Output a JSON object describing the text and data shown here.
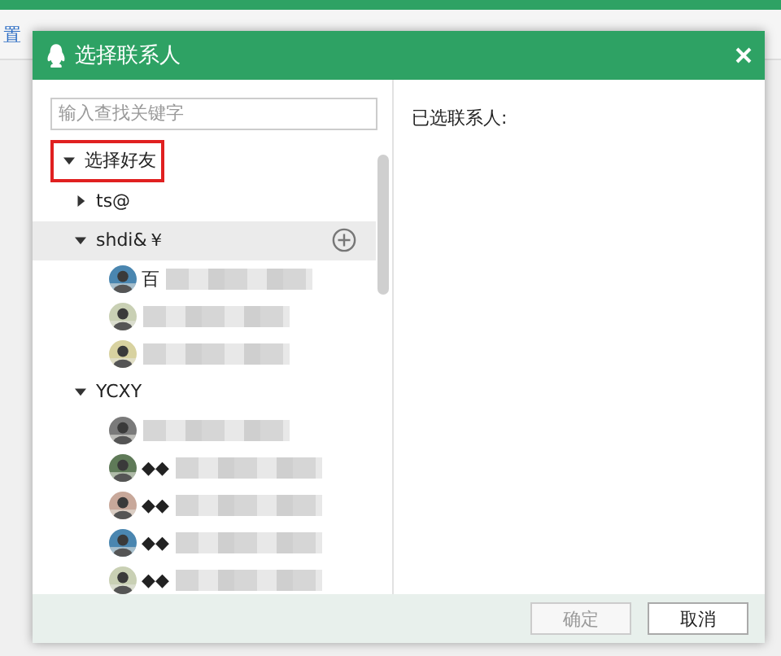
{
  "background": {
    "toolbar_text": "置"
  },
  "dialog": {
    "title": "选择联系人",
    "search": {
      "placeholder": "输入查找关键字"
    },
    "selected_label": "已选联系人:",
    "tree": [
      {
        "label": "选择好友",
        "expanded": true,
        "highlighted": true,
        "children": [
          {
            "label": "ts@",
            "expanded": false,
            "hovered": false
          },
          {
            "label": "shdi&￥",
            "expanded": true,
            "hovered": true,
            "children": [
              {
                "kind": "picture",
                "name": "百"
              },
              {
                "kind": "picture"
              },
              {
                "kind": "picture"
              }
            ]
          },
          {
            "label": "YCXY",
            "expanded": true,
            "hovered": false,
            "children": [
              {
                "kind": "picture"
              },
              {
                "kind": "picture",
                "name": "◆◆"
              },
              {
                "kind": "picture",
                "name": "◆◆"
              },
              {
                "kind": "picture",
                "name": "◆◆"
              },
              {
                "kind": "picture",
                "name": "◆◆"
              }
            ]
          }
        ]
      }
    ],
    "buttons": [
      {
        "label": "确定",
        "disabled": true
      },
      {
        "label": "取消",
        "disabled": false
      }
    ]
  }
}
